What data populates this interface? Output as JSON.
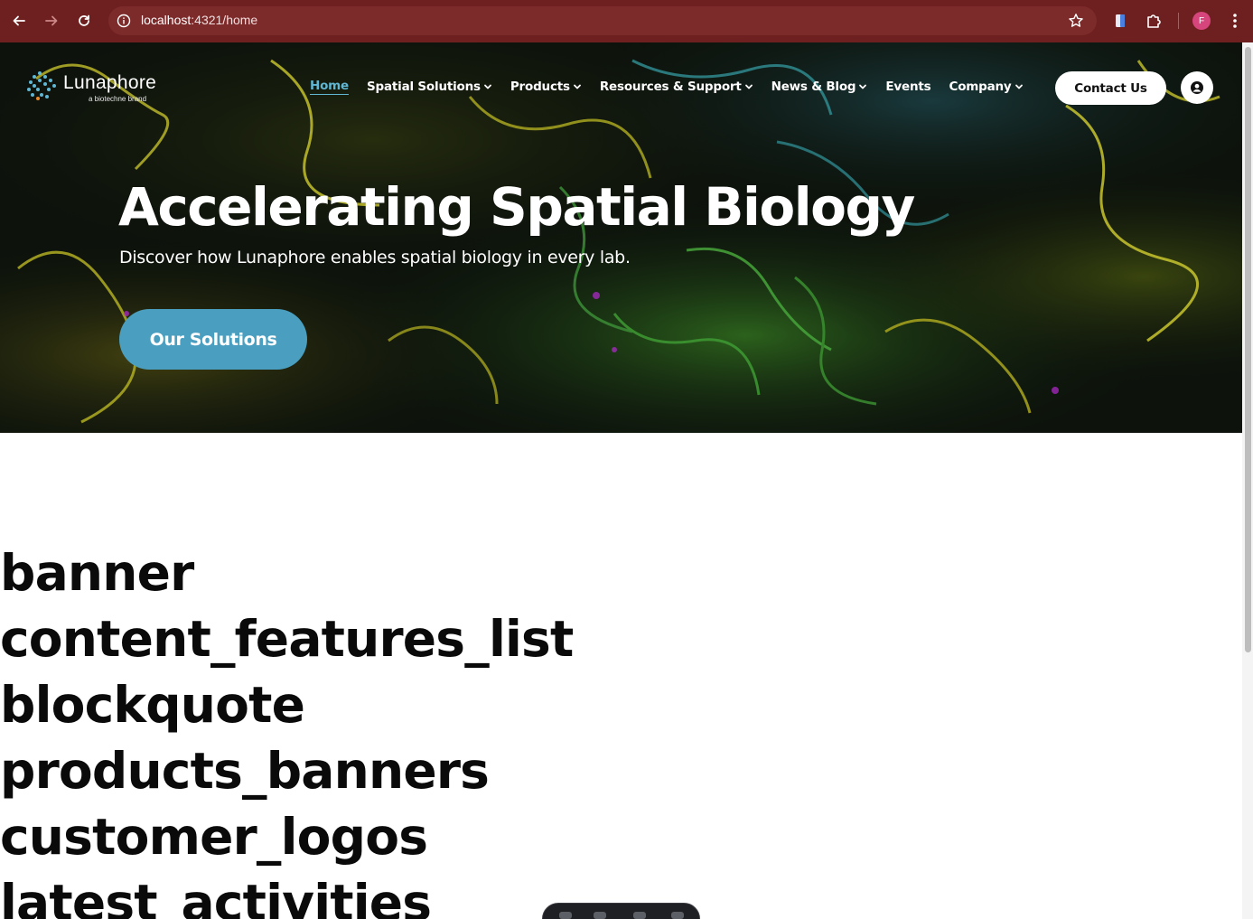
{
  "browser": {
    "url_host": "localhost",
    "url_path": ":4321/home",
    "profile_initial": "F"
  },
  "site": {
    "logo_name": "Lunaphore",
    "logo_tagline": "a biotechne brand",
    "nav": [
      {
        "label": "Home",
        "active": true,
        "dropdown": false
      },
      {
        "label": "Spatial Solutions",
        "active": false,
        "dropdown": true
      },
      {
        "label": "Products",
        "active": false,
        "dropdown": true
      },
      {
        "label": "Resources & Support",
        "active": false,
        "dropdown": true
      },
      {
        "label": "News & Blog",
        "active": false,
        "dropdown": true
      },
      {
        "label": "Events",
        "active": false,
        "dropdown": false
      },
      {
        "label": "Company",
        "active": false,
        "dropdown": true
      }
    ],
    "contact_label": "Contact Us"
  },
  "hero": {
    "title": "Accelerating Spatial Biology",
    "subtitle": "Discover how Lunaphore enables spatial biology in every lab.",
    "cta_label": "Our Solutions"
  },
  "sections": [
    "banner",
    "content_features_list",
    "blockquote",
    "products_banners",
    "customer_logos",
    "latest_activities"
  ],
  "colors": {
    "chrome": "#6e1f1f",
    "accent": "#5fb7d4",
    "cta": "#4a9fc0"
  }
}
